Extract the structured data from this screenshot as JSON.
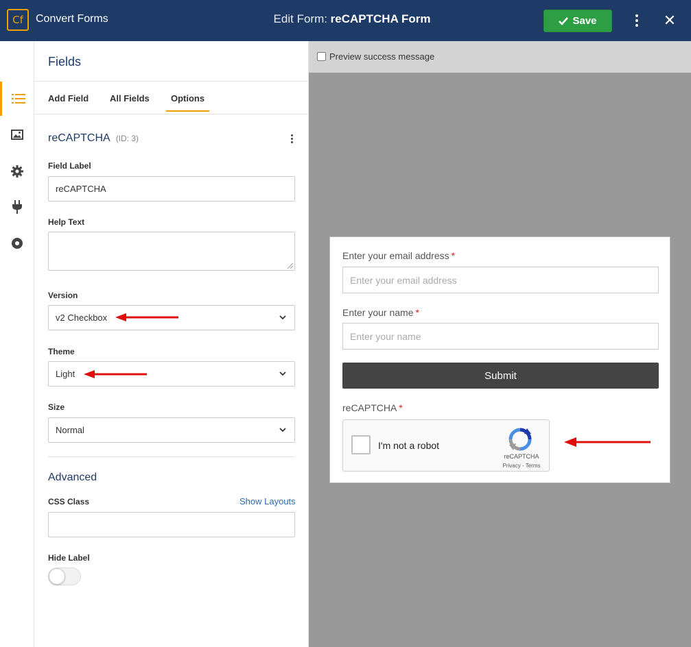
{
  "header": {
    "logo_text": "Cf",
    "brand": "Convert Forms",
    "title_prefix": "Edit Form: ",
    "title_form": "reCAPTCHA Form",
    "save_label": "Save"
  },
  "rail": {
    "items": [
      {
        "icon": "list-icon",
        "active": true
      },
      {
        "icon": "image-icon",
        "active": false
      },
      {
        "icon": "gear-icon",
        "active": false
      },
      {
        "icon": "plug-icon",
        "active": false
      },
      {
        "icon": "record-icon",
        "active": false
      }
    ]
  },
  "panel": {
    "title": "Fields",
    "tabs": [
      {
        "label": "Add Field"
      },
      {
        "label": "All Fields"
      },
      {
        "label": "Options",
        "active": true
      }
    ],
    "field_name": "reCAPTCHA",
    "field_id": "(ID: 3)",
    "field_label_label": "Field Label",
    "field_label_value": "reCAPTCHA",
    "help_text_label": "Help Text",
    "version_label": "Version",
    "version_value": "v2 Checkbox",
    "theme_label": "Theme",
    "theme_value": "Light",
    "size_label": "Size",
    "size_value": "Normal",
    "advanced_title": "Advanced",
    "css_class_label": "CSS Class",
    "show_layouts": "Show Layouts",
    "hide_label_label": "Hide Label"
  },
  "preview": {
    "success_label": "Preview success message",
    "email_label": "Enter your email address",
    "email_placeholder": "Enter your email address",
    "name_label": "Enter your name",
    "name_placeholder": "Enter your name",
    "required_mark": "*",
    "submit_label": "Submit",
    "recaptcha_label": "reCAPTCHA",
    "recaptcha_checkbox_text": "I'm not a robot",
    "recaptcha_brand": "reCAPTCHA",
    "recaptcha_links": "Privacy - Terms"
  },
  "colors": {
    "header_bg": "#1e3a66",
    "accent": "#f0a000",
    "save_green": "#2e9e44",
    "submit_dark": "#444444",
    "annotation_red": "#e01010"
  }
}
